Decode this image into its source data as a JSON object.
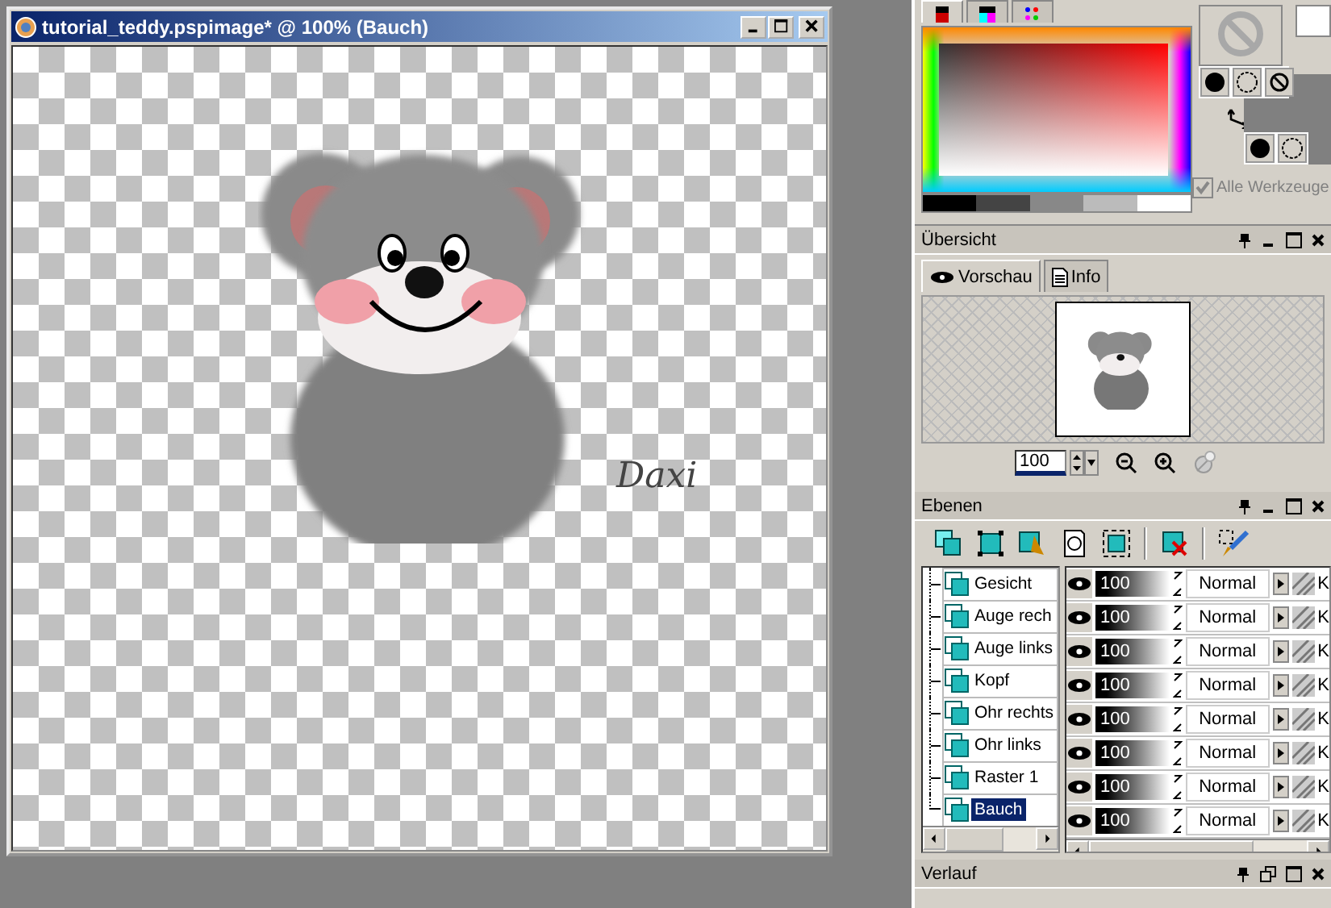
{
  "document": {
    "title": "tutorial_teddy.pspimage* @ 100% (Bauch)",
    "signature": "Daxi"
  },
  "materials": {
    "tabs": [
      {
        "selected": true
      },
      {
        "selected": false
      },
      {
        "selected": false
      }
    ],
    "all_tools": {
      "label": "Alle Werkzeuge",
      "checked": true,
      "disabled": true
    }
  },
  "overview": {
    "title": "Übersicht",
    "tabs": [
      {
        "label": "Vorschau",
        "selected": true
      },
      {
        "label": "Info",
        "selected": false
      }
    ],
    "zoom": "100"
  },
  "layers": {
    "title": "Ebenen",
    "items": [
      {
        "name": "Gesicht",
        "selected": false,
        "visible": true,
        "level": 1,
        "opacity": "100",
        "blend_mode": "Normal",
        "column_5": "K"
      },
      {
        "name": "Auge rech",
        "selected": false,
        "visible": true,
        "level": 1,
        "opacity": "100",
        "blend_mode": "Normal",
        "column_5": "K"
      },
      {
        "name": "Auge links",
        "selected": false,
        "visible": true,
        "level": 1,
        "opacity": "100",
        "blend_mode": "Normal",
        "column_5": "K"
      },
      {
        "name": "Kopf",
        "selected": false,
        "visible": true,
        "level": 1,
        "opacity": "100",
        "blend_mode": "Normal",
        "column_5": "K"
      },
      {
        "name": "Ohr rechts",
        "selected": false,
        "visible": true,
        "level": 1,
        "opacity": "100",
        "blend_mode": "Normal",
        "column_5": "K"
      },
      {
        "name": "Ohr links",
        "selected": false,
        "visible": true,
        "level": 1,
        "opacity": "100",
        "blend_mode": "Normal",
        "column_5": "K"
      },
      {
        "name": "Raster 1",
        "selected": false,
        "visible": true,
        "level": 1,
        "opacity": "100",
        "blend_mode": "Normal",
        "column_5": "K"
      },
      {
        "name": "Bauch",
        "selected": true,
        "visible": true,
        "level": 1,
        "opacity": "100",
        "blend_mode": "Normal",
        "column_5": "K"
      }
    ]
  },
  "history": {
    "title": "Verlauf"
  }
}
